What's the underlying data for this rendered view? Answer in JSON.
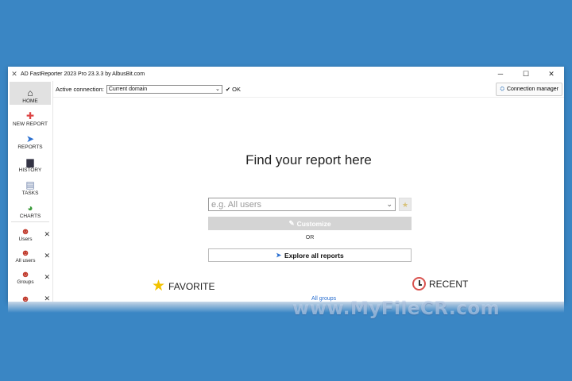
{
  "window": {
    "title": "AD FastReporter 2023 Pro 23.3.3 by AlbusBit.com",
    "controls": {
      "minimize": "─",
      "maximize": "☐",
      "close": "✕"
    }
  },
  "toolbar": {
    "connection_label": "Active connection:",
    "connection_value": "Current domain",
    "ok_label": "OK",
    "connection_manager_label": "Connection manager"
  },
  "sidebar": {
    "nav": [
      {
        "label": "HOME",
        "icon": "home-icon"
      },
      {
        "label": "NEW REPORT",
        "icon": "new-report-icon"
      },
      {
        "label": "REPORTS",
        "icon": "reports-icon"
      },
      {
        "label": "HISTORY",
        "icon": "history-icon"
      },
      {
        "label": "TASKS",
        "icon": "tasks-icon"
      },
      {
        "label": "CHARTS",
        "icon": "charts-icon"
      }
    ],
    "objects": [
      {
        "label": "Users"
      },
      {
        "label": "All users"
      },
      {
        "label": "Groups"
      },
      {
        "label": ""
      }
    ]
  },
  "main": {
    "heading": "Find your report here",
    "search_placeholder": "e.g. All users",
    "customize_label": "Customize",
    "or_label": "OR",
    "explore_label": "Explore all reports",
    "favorite_label": "FAVORITE",
    "recent_label": "RECENT",
    "all_groups_link": "All groups"
  },
  "watermark": "www.MyFileCR.com",
  "colors": {
    "background": "#3a86c4",
    "accent_star": "#f2c200",
    "recent_clock": "#d9534f",
    "link": "#2a6fd0"
  }
}
